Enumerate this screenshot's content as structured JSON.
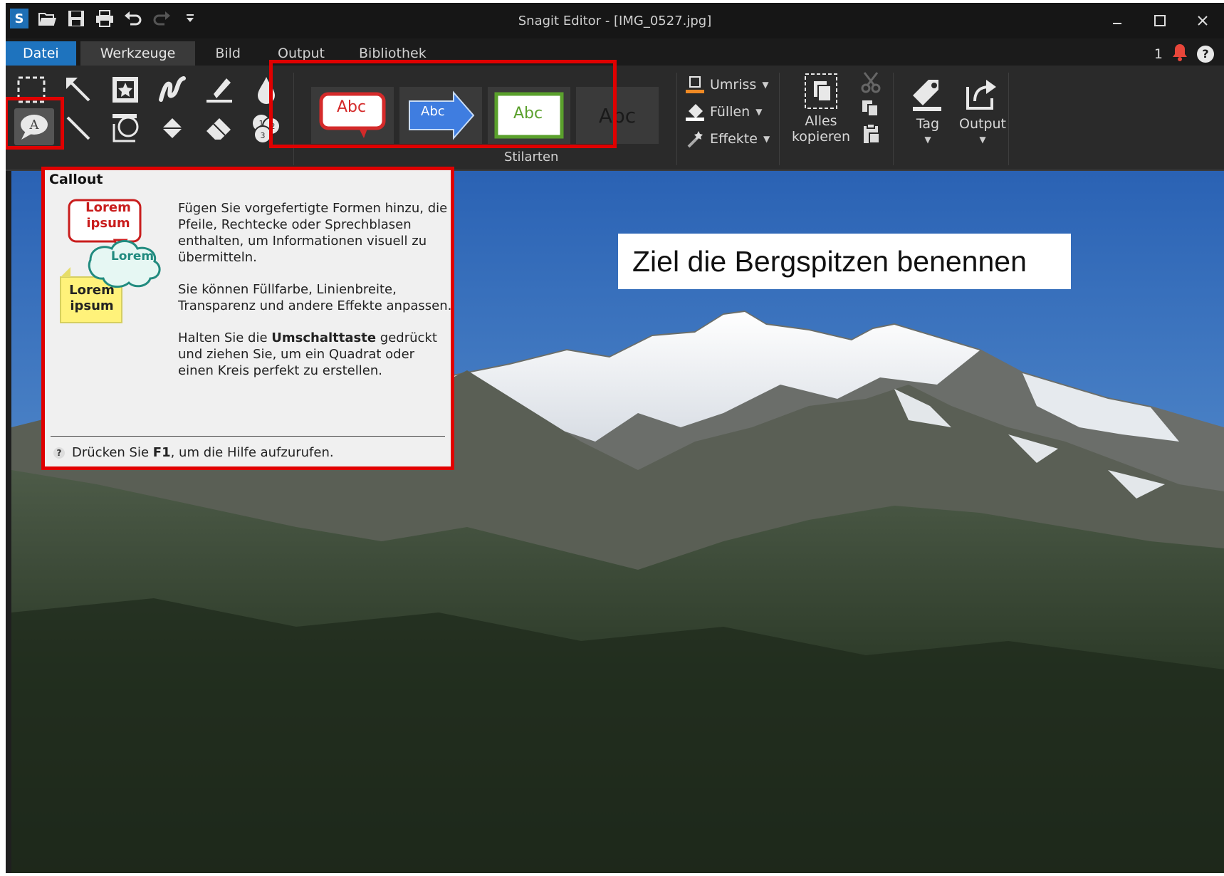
{
  "window": {
    "title": "Snagit Editor - [IMG_0527.jpg]",
    "app_logo": "S",
    "controls": [
      "minimize-icon",
      "maximize-icon",
      "close-icon"
    ]
  },
  "quick_access": [
    "open-icon",
    "save-icon",
    "print-icon",
    "undo-icon",
    "redo-icon",
    "customize-icon"
  ],
  "menu": {
    "tabs": [
      "Datei",
      "Werkzeuge",
      "Bild",
      "Output",
      "Bibliothek"
    ],
    "active_tab": "Werkzeuge",
    "notification_count": "1",
    "help_label": "?"
  },
  "ribbon": {
    "tools": [
      "selection-icon",
      "arrow-icon",
      "stamp-icon",
      "pen-icon",
      "highlighter-icon",
      "blur-icon",
      "callout-icon",
      "line-icon",
      "shape-icon",
      "fill-icon",
      "eraser-icon",
      "step-icon"
    ],
    "selected_tool": "callout-icon",
    "styles": {
      "label": "Stilarten",
      "tiles": [
        "Abc",
        "Abc",
        "Abc",
        "Abc"
      ]
    },
    "properties": {
      "outline": "Umriss",
      "fill": "Füllen",
      "effects": "Effekte"
    },
    "copy_all": {
      "line1": "Alles",
      "line2": "kopieren"
    },
    "tag": "Tag",
    "output": "Output"
  },
  "tooltip": {
    "title": "Callout",
    "sample_text_1": "Lorem",
    "sample_text_2": "ipsum",
    "sample_text_3": "Lorem",
    "sample_text_4": "Lorem",
    "sample_text_5": "ipsum",
    "paragraph_1": "Fügen Sie vorgefertigte Formen hinzu, die Pfeile, Rechtecke oder Sprechblasen enthalten, um Informationen visuell zu übermitteln.",
    "paragraph_2": "Sie können Füllfarbe, Linienbreite, Transparenz und andere Effekte anpassen.",
    "paragraph_3_pre": "Halten Sie die ",
    "paragraph_3_bold": "Umschalttaste",
    "paragraph_3_post": " gedrückt und ziehen Sie, um ein Quadrat oder einen Kreis perfekt zu erstellen.",
    "footer_icon": "?",
    "footer_pre": "Drücken Sie ",
    "footer_bold": "F1",
    "footer_post": ", um die Hilfe aufzurufen."
  },
  "canvas": {
    "note_text": "Ziel die Bergspitzen benennen"
  },
  "colors": {
    "highlight_red": "#e00000",
    "file_tab_blue": "#1e73be",
    "sky_top": "#2d68b8",
    "notification": "#e8463a"
  }
}
